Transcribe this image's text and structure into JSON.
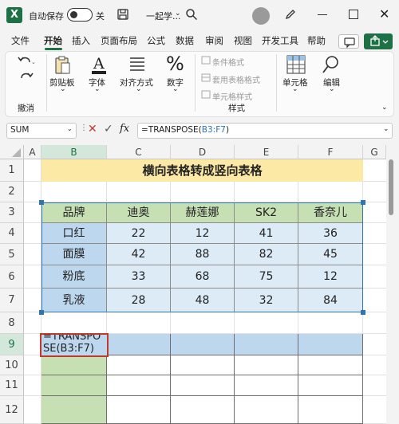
{
  "titlebar": {
    "app_icon": "X",
    "autosave_label": "自动保存",
    "autosave_state": "关",
    "doc_title": "一起学...",
    "icons": [
      "excel-icon",
      "save-icon",
      "search-icon",
      "avatar",
      "pen-icon",
      "minimize-icon",
      "maximize-icon",
      "close-icon"
    ]
  },
  "tabs": [
    "文件",
    "开始",
    "插入",
    "页面布局",
    "公式",
    "数据",
    "审阅",
    "视图",
    "开发工具",
    "帮助"
  ],
  "active_tab": "开始",
  "ribbon": {
    "undo_group": "撤消",
    "clipboard": "剪贴板",
    "font": "字体",
    "alignment": "对齐方式",
    "number": "数字",
    "conditional_format": "条件格式",
    "table_format": "套用表格格式",
    "cell_style": "单元格样式",
    "styles_group": "样式",
    "cells": "单元格",
    "editing": "编辑"
  },
  "formula_bar": {
    "name_box": "SUM",
    "fx": "fx",
    "formula_prefix": "=TRANSPOSE(",
    "formula_ref": "B3:F7",
    "formula_suffix": ")"
  },
  "grid": {
    "columns": [
      "A",
      "B",
      "C",
      "D",
      "E",
      "F",
      "G"
    ],
    "rows": [
      "1",
      "2",
      "3",
      "4",
      "5",
      "6",
      "7",
      "8",
      "9",
      "10",
      "11",
      "12"
    ],
    "title": "横向表格转成竖向表格",
    "source_table": {
      "header": [
        "品牌",
        "迪奥",
        "赫莲娜",
        "SK2",
        "香奈儿"
      ],
      "rows": [
        [
          "口红",
          "22",
          "12",
          "41",
          "36"
        ],
        [
          "面膜",
          "42",
          "88",
          "82",
          "45"
        ],
        [
          "粉底",
          "33",
          "68",
          "75",
          "12"
        ],
        [
          "乳液",
          "28",
          "48",
          "32",
          "84"
        ]
      ]
    },
    "edit_cell_line1": "=TRANSPO",
    "edit_cell_line2": "SE(B3:F7)"
  },
  "colors": {
    "accent": "#1e7145",
    "title_fill": "#fce9a6",
    "header_fill": "#c6e0b4",
    "row_label_fill": "#bdd7ee",
    "data_fill": "#ddebf7",
    "reference_border": "#2e75b6",
    "edit_border": "#c0392b"
  }
}
